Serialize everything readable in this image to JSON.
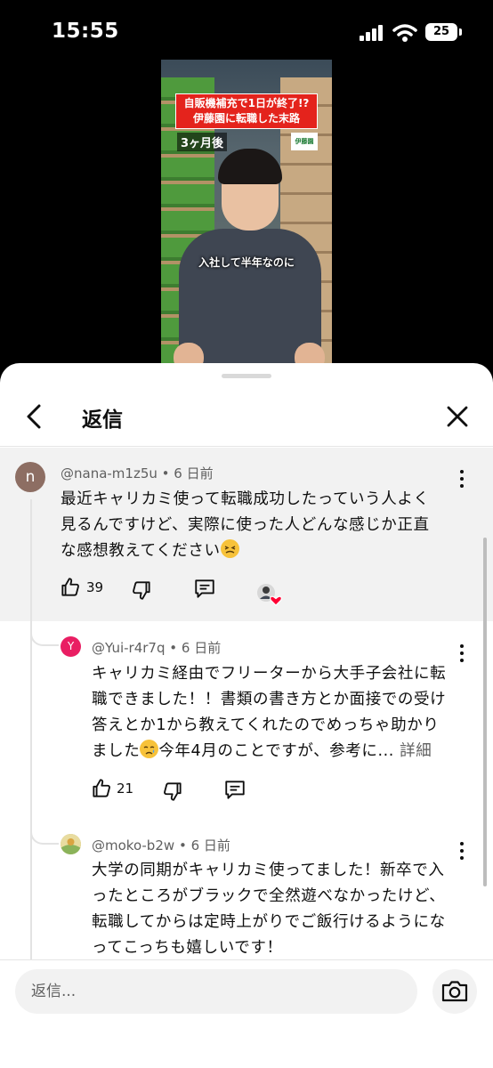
{
  "status_bar": {
    "time": "15:55",
    "battery": "25"
  },
  "video": {
    "title_lines": [
      "自販機補充で1日が終了!?",
      "伊藤園に転職した末路"
    ],
    "tag": "3ヶ月後",
    "logo": "伊藤園",
    "caption": "入社して半年なのに"
  },
  "sheet": {
    "title": "返信"
  },
  "comments": {
    "parent": {
      "avatar_letter": "n",
      "author": "@nana-m1z5u",
      "time": "6 日前",
      "lines": [
        "最近キャリカミ使って転職成功したっていう人よく",
        "見るんですけど、実際に使った人どんな感じか正直",
        "な感想教えてください"
      ],
      "likes": "39"
    },
    "replies": [
      {
        "avatar_letter": "Y",
        "author": "@Yui-r4r7q",
        "time": "6 日前",
        "lines": [
          "キャリカミ経由でフリーターから大手子会社に転",
          "職できました！！書類の書き方とか面接での受け",
          "答えとか1から教えてくれたのでめっちゃ助かり",
          "ました"
        ],
        "line4_tail": "今年4月のことですが、参考に...",
        "more": "詳細",
        "likes": "21"
      },
      {
        "author": "@moko-b2w",
        "time": "6 日前",
        "lines": [
          "大学の同期がキャリカミ使ってました！新卒で入",
          "ったところがブラックで全然遊べなかったけど、",
          "転職してからは定時上がりでご飯行けるようにな",
          "ってこっちも嬉しいです！"
        ]
      }
    ]
  },
  "composer": {
    "placeholder": "返信..."
  },
  "icons": {
    "back": "chevron-left-icon",
    "close": "close-icon",
    "like": "thumbs-up-icon",
    "dislike": "thumbs-down-icon",
    "reply": "reply-comment-icon",
    "more": "more-vertical-icon",
    "camera": "camera-icon"
  },
  "colors": {
    "accent_heart": "#ff0033",
    "parent_bg": "#f2f2f2"
  }
}
